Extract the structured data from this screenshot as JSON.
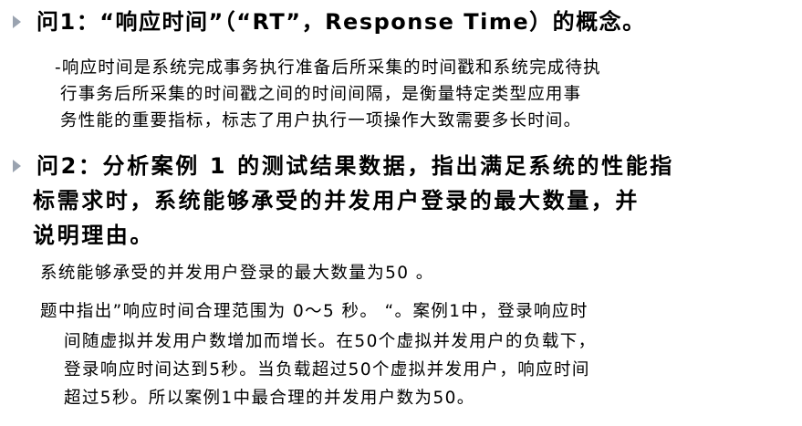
{
  "q1": {
    "text": "问1：“响应时间”（“RT”，Response Time）的概念。"
  },
  "a1": {
    "lines": [
      "-响应时间是系统完成事务执行准备后所采集的时间戳和系统完成待执",
      "行事务后所采集的时间戳之间的时间间隔，是衡量特定类型应用事",
      "务性能的重要指标，标志了用户执行一项操作大致需要多长时间。"
    ]
  },
  "q2": {
    "lines": [
      "问2：分析案例 1 的测试结果数据，指出满足系统的性能指",
      "标需求时，系统能够承受的并发用户登录的最大数量，并",
      "说明理由。"
    ]
  },
  "a2": {
    "lines": [
      "系统能够承受的并发用户登录的最大数量为50 。",
      "题中指出”响应时间合理范围为 0～5 秒。 “。案例1中，登录响应时",
      "间随虚拟并发用户数增加而增长。在50个虚拟并发用户的负载下，",
      "登录响应时间达到5秒。当负载超过50个虚拟并发用户，响应时间",
      "超过5秒。所以案例1中最合理的并发用户数为50。"
    ]
  },
  "colors": {
    "bullet": "#9aa3b0",
    "text": "#000000",
    "background": "#ffffff"
  },
  "icons": {
    "bullet": "triangle-bullet-icon"
  }
}
